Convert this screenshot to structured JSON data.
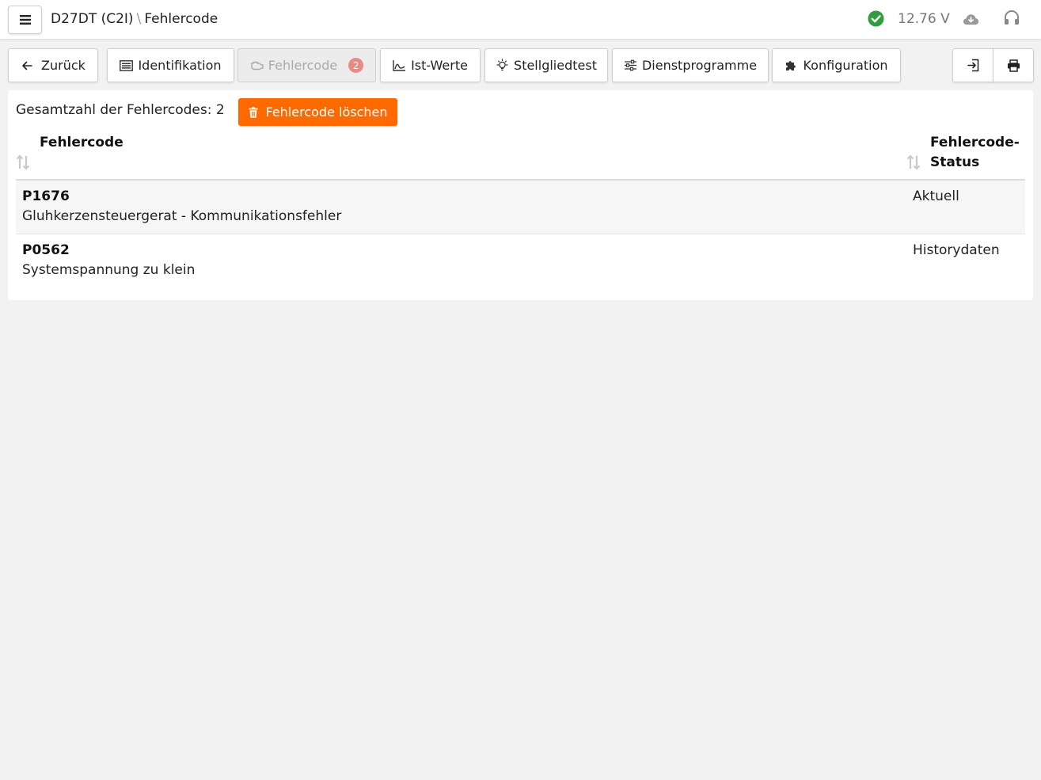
{
  "header": {
    "ecu": "D27DT (C2I)",
    "separator": "\\",
    "page": "Fehlercode",
    "voltage": "12.76 V",
    "icons": [
      "menu-icon",
      "check-circle-icon",
      "cloud-download-icon",
      "headset-icon"
    ],
    "status_color": "#2e9e3e"
  },
  "tabs": {
    "back": "Zurück",
    "identifikation": "Identifikation",
    "fehlercode": "Fehlercode",
    "fehlercode_count": "2",
    "ist_werte": "Ist-Werte",
    "stellgliedtest": "Stellgliedtest",
    "dienstprogramme": "Dienstprogramme",
    "konfiguration": "Konfiguration",
    "icons": [
      "arrow-left-icon",
      "list-icon",
      "engine-icon",
      "chart-icon",
      "bulb-icon",
      "sliders-icon",
      "puzzle-icon",
      "export-icon",
      "print-icon"
    ]
  },
  "main": {
    "total_label": "Gesamtzahl der Fehlercodes: 2",
    "clear_button": "Fehlercode löschen",
    "accent_color": "#ff6a00",
    "columns": {
      "code": "Fehlercode",
      "status_line1": "Fehlercode-",
      "status_line2": "Status"
    },
    "rows": [
      {
        "code": "P1676",
        "description": "Gluhkerzensteuergerat - Kommunikationsfehler",
        "status": "Aktuell"
      },
      {
        "code": "P0562",
        "description": "Systemspannung zu klein",
        "status": "Historydaten"
      }
    ]
  }
}
